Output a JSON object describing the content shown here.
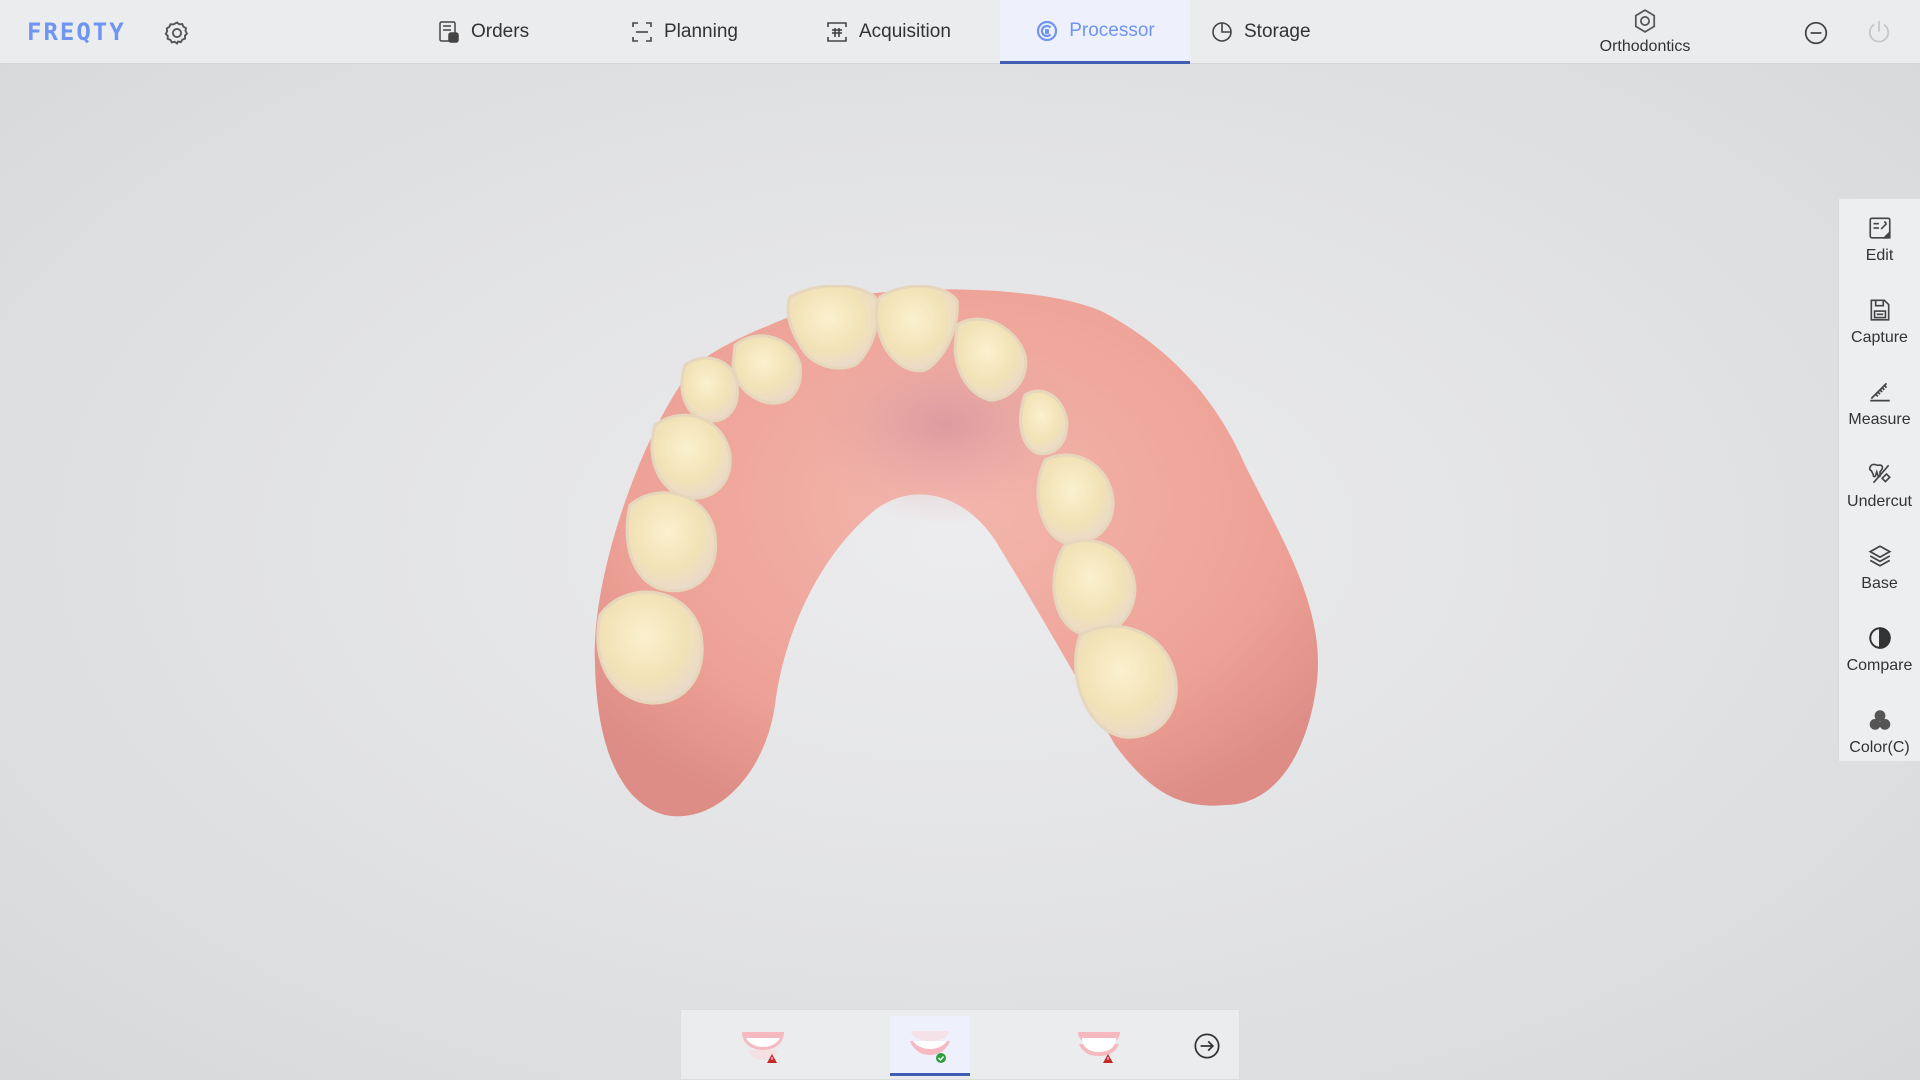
{
  "app": {
    "logo": "FREQTY"
  },
  "nav": {
    "tabs": [
      {
        "label": "Orders",
        "icon": "orders-icon",
        "active": false
      },
      {
        "label": "Planning",
        "icon": "planning-icon",
        "active": false
      },
      {
        "label": "Acquisition",
        "icon": "acquisition-icon",
        "active": false
      },
      {
        "label": "Processor",
        "icon": "processor-icon",
        "active": true
      },
      {
        "label": "Storage",
        "icon": "storage-icon",
        "active": false
      }
    ],
    "mode": {
      "label": "Orthodontics",
      "icon": "hexagon-icon"
    }
  },
  "toolbar": {
    "items": [
      {
        "label": "Edit",
        "icon": "edit-icon"
      },
      {
        "label": "Capture",
        "icon": "save-icon"
      },
      {
        "label": "Measure",
        "icon": "ruler-icon"
      },
      {
        "label": "Undercut",
        "icon": "undercut-icon"
      },
      {
        "label": "Base",
        "icon": "layers-icon"
      },
      {
        "label": "Compare",
        "icon": "compare-icon"
      },
      {
        "label": "Color(C)",
        "icon": "color-icon"
      }
    ]
  },
  "bottom": {
    "jaws": [
      {
        "name": "upper-jaw",
        "status": "warning"
      },
      {
        "name": "lower-jaw",
        "status": "ok",
        "active": true
      },
      {
        "name": "both-jaws",
        "status": "warning"
      }
    ]
  },
  "colors": {
    "accent": "#6f94f2",
    "active_underline": "#3e5db3",
    "warning": "#c62828",
    "ok": "#2e9e3e"
  }
}
